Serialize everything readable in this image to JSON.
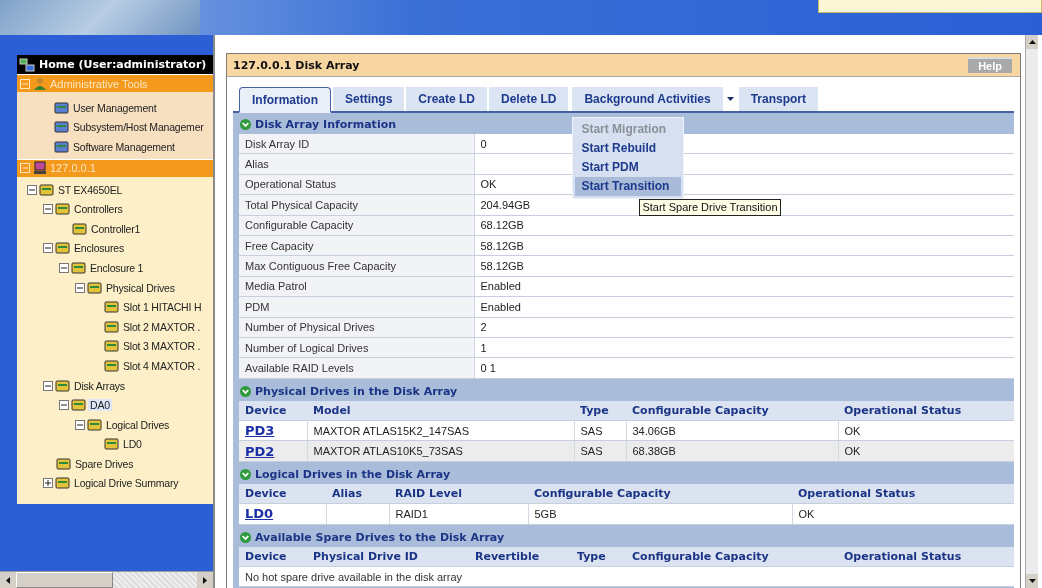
{
  "sidebar": {
    "header": "Home (User:administrator)",
    "groups": [
      {
        "label": "Administrative Tools",
        "expanded": true,
        "children": [
          {
            "label": "User Management",
            "selected": false
          },
          {
            "label": "Subsystem/Host Managemer",
            "selected": false
          },
          {
            "label": "Software Management",
            "selected": false
          }
        ]
      },
      {
        "label": "127.0.0.1",
        "expanded": true,
        "children": [
          {
            "label": "ST EX4650EL",
            "expanded": true,
            "selected": false,
            "children": [
              {
                "label": "Controllers",
                "expanded": true,
                "selected": false,
                "children": [
                  {
                    "label": "Controller1",
                    "selected": false
                  }
                ]
              },
              {
                "label": "Enclosures",
                "expanded": true,
                "selected": false,
                "children": [
                  {
                    "label": "Enclosure 1",
                    "expanded": true,
                    "selected": false,
                    "children": [
                      {
                        "label": "Physical Drives",
                        "expanded": true,
                        "selected": false,
                        "children": [
                          {
                            "label": "Slot 1 HITACHI H",
                            "selected": false
                          },
                          {
                            "label": "Slot 2 MAXTOR .",
                            "selected": false
                          },
                          {
                            "label": "Slot 3 MAXTOR .",
                            "selected": false
                          },
                          {
                            "label": "Slot 4 MAXTOR .",
                            "selected": false
                          }
                        ]
                      }
                    ]
                  }
                ]
              },
              {
                "label": "Disk Arrays",
                "expanded": true,
                "selected": false,
                "children": [
                  {
                    "label": "DA0",
                    "expanded": true,
                    "selected": true,
                    "children": [
                      {
                        "label": "Logical Drives",
                        "expanded": true,
                        "selected": false,
                        "children": [
                          {
                            "label": "LD0",
                            "selected": false
                          }
                        ]
                      }
                    ]
                  }
                ]
              },
              {
                "label": "Spare Drives",
                "selected": false
              },
              {
                "label": "Logical Drive Summary",
                "expanded": false,
                "selected": false
              }
            ]
          }
        ]
      }
    ]
  },
  "panel": {
    "title": "127.0.0.1 Disk Array",
    "help": "Help"
  },
  "tabs": [
    {
      "label": "Information",
      "selected": true,
      "kind": "tab"
    },
    {
      "label": "Settings",
      "selected": false,
      "kind": "tab"
    },
    {
      "label": "Create LD",
      "selected": false,
      "kind": "tab"
    },
    {
      "label": "Delete LD",
      "selected": false,
      "kind": "tab"
    },
    {
      "label": "Background Activities",
      "selected": false,
      "kind": "dropdown",
      "menu": [
        {
          "label": "Start Migration",
          "disabled": true,
          "selected": false
        },
        {
          "label": "Start Rebuild",
          "disabled": false,
          "selected": false
        },
        {
          "label": "Start PDM",
          "disabled": false,
          "selected": false
        },
        {
          "label": "Start Transition",
          "disabled": false,
          "selected": true
        }
      ],
      "tooltip": "Start Spare Drive Transition"
    },
    {
      "label": "Transport",
      "selected": false,
      "kind": "tab"
    }
  ],
  "disk_array_information": {
    "title": "Disk Array Information",
    "rows": [
      {
        "label": "Disk Array ID",
        "value": "0"
      },
      {
        "label": "Alias"
      },
      {
        "label": "Operational Status",
        "value": "OK"
      },
      {
        "label": "Total Physical Capacity",
        "value": "204.94GB"
      },
      {
        "label": "Configurable Capacity",
        "value": "68.12GB"
      },
      {
        "label": "Free Capacity",
        "value": "58.12GB"
      },
      {
        "label": "Max Contiguous Free Capacity",
        "value": "58.12GB"
      },
      {
        "label": "Media Patrol",
        "value": "Enabled"
      },
      {
        "label": "PDM",
        "value": "Enabled"
      },
      {
        "label": "Number of Physical Drives",
        "value": "2"
      },
      {
        "label": "Number of Logical Drives",
        "value": "1"
      },
      {
        "label": "Available RAID Levels",
        "value": "0 1"
      }
    ]
  },
  "tables": [
    {
      "title": "Physical Drives in the Disk Array",
      "columns": [
        "Device",
        "Model",
        "Type",
        "Configurable Capacity",
        "Operational Status"
      ],
      "rows": [
        [
          "PD3",
          "MAXTOR ATLAS15K2_147SAS",
          "SAS",
          "34.06GB",
          "OK"
        ],
        [
          "PD2",
          "MAXTOR ATLAS10K5_73SAS",
          "SAS",
          "68.38GB",
          "OK"
        ]
      ]
    },
    {
      "title": "Logical Drives in the Disk Array",
      "columns": [
        "Device",
        "Alias",
        "RAID Level",
        "Configurable Capacity",
        "Operational Status"
      ],
      "rows": [
        [
          "LD0",
          null,
          "RAID1",
          "5GB",
          "OK"
        ]
      ]
    },
    {
      "title": "Available Spare Drives to the Disk Array",
      "columns": [
        "Device",
        "Physical Drive ID",
        "Revertible",
        "Type",
        "Configurable Capacity",
        "Operational Status"
      ],
      "message": "No hot spare drive available in the disk array"
    }
  ]
}
